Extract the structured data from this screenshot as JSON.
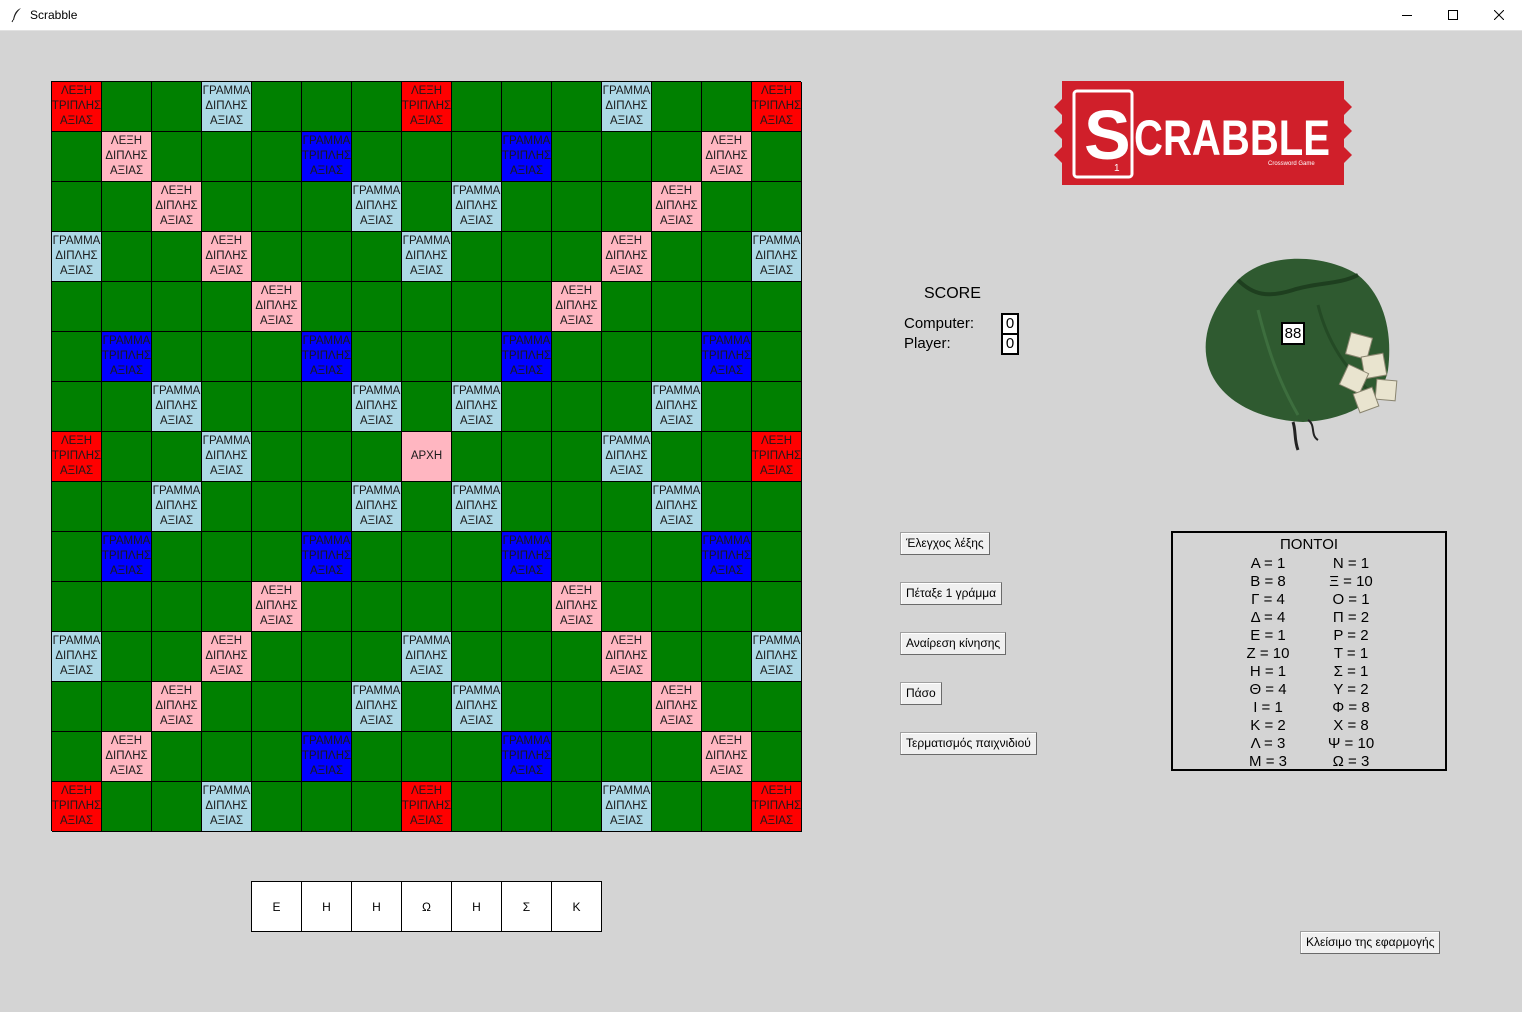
{
  "window": {
    "title": "Scrabble"
  },
  "board": {
    "rows": [
      [
        "TW",
        "",
        "",
        "DL",
        "",
        "",
        "",
        "TW",
        "",
        "",
        "",
        "DL",
        "",
        "",
        "TW"
      ],
      [
        "",
        "DW",
        "",
        "",
        "",
        "TL",
        "",
        "",
        "",
        "TL",
        "",
        "",
        "",
        "DW",
        ""
      ],
      [
        "",
        "",
        "DW",
        "",
        "",
        "",
        "DL",
        "",
        "DL",
        "",
        "",
        "",
        "DW",
        "",
        ""
      ],
      [
        "DL",
        "",
        "",
        "DW",
        "",
        "",
        "",
        "DL",
        "",
        "",
        "",
        "DW",
        "",
        "",
        "DL"
      ],
      [
        "",
        "",
        "",
        "",
        "DW",
        "",
        "",
        "",
        "",
        "",
        "DW",
        "",
        "",
        "",
        ""
      ],
      [
        "",
        "TL",
        "",
        "",
        "",
        "TL",
        "",
        "",
        "",
        "TL",
        "",
        "",
        "",
        "TL",
        ""
      ],
      [
        "",
        "",
        "DL",
        "",
        "",
        "",
        "DL",
        "",
        "DL",
        "",
        "",
        "",
        "DL",
        "",
        ""
      ],
      [
        "TW",
        "",
        "",
        "DL",
        "",
        "",
        "",
        "ST",
        "",
        "",
        "",
        "DL",
        "",
        "",
        "TW"
      ],
      [
        "",
        "",
        "DL",
        "",
        "",
        "",
        "DL",
        "",
        "DL",
        "",
        "",
        "",
        "DL",
        "",
        ""
      ],
      [
        "",
        "TL",
        "",
        "",
        "",
        "TL",
        "",
        "",
        "",
        "TL",
        "",
        "",
        "",
        "TL",
        ""
      ],
      [
        "",
        "",
        "",
        "",
        "DW",
        "",
        "",
        "",
        "",
        "",
        "DW",
        "",
        "",
        "",
        ""
      ],
      [
        "DL",
        "",
        "",
        "DW",
        "",
        "",
        "",
        "DL",
        "",
        "",
        "",
        "DW",
        "",
        "",
        "DL"
      ],
      [
        "",
        "",
        "DW",
        "",
        "",
        "",
        "DL",
        "",
        "DL",
        "",
        "",
        "",
        "DW",
        "",
        ""
      ],
      [
        "",
        "DW",
        "",
        "",
        "",
        "TL",
        "",
        "",
        "",
        "TL",
        "",
        "",
        "",
        "DW",
        ""
      ],
      [
        "TW",
        "",
        "",
        "DL",
        "",
        "",
        "",
        "TW",
        "",
        "",
        "",
        "DL",
        "",
        "",
        "TW"
      ]
    ],
    "labels": {
      "TW": "ΛΕΞΗ\nΤΡΙΠΛΗΣ\nΑΞΙΑΣ",
      "DW": "ΛΕΞΗ\nΔΙΠΛΗΣ\nΑΞΙΑΣ",
      "DL": "ΓΡΑΜΜΑ\nΔΙΠΛΗΣ\nΑΞΙΑΣ",
      "TL": "ΓΡΑΜΜΑ\nΤΡΙΠΛΗΣ\nΑΞΙΑΣ",
      "ST": "ΑΡΧΗ"
    }
  },
  "rack": [
    "Ε",
    "Η",
    "Η",
    "Ω",
    "Η",
    "Σ",
    "Κ"
  ],
  "logo": {
    "text": "SCRABBLE",
    "tile_number": "1",
    "subtitle": "Crossword Game"
  },
  "score": {
    "title": "SCORE",
    "computer_label": "Computer:",
    "computer_value": "0",
    "player_label": "Player:",
    "player_value": "0"
  },
  "bag": {
    "remaining": "88"
  },
  "buttons": {
    "check_word": "Έλεγχος λέξης",
    "throw_letter": "Πέταξε 1 γράμμα",
    "undo_move": "Αναίρεση κίνησης",
    "pass": "Πάσο",
    "end_game": "Τερματισμός παιχνιδιού",
    "close_app": "Κλείσιμο της εφαρμογής"
  },
  "points": {
    "title": "ΠΟΝΤΟΙ",
    "rows": [
      [
        "Α = 1",
        "Ν = 1"
      ],
      [
        "Β = 8",
        "Ξ = 10"
      ],
      [
        "Γ = 4",
        "Ο = 1"
      ],
      [
        "Δ = 4",
        "Π = 2"
      ],
      [
        "Ε = 1",
        "Ρ = 2"
      ],
      [
        "Ζ = 10",
        "Τ = 1"
      ],
      [
        "Η = 1",
        "Σ = 1"
      ],
      [
        "Θ = 4",
        "Υ = 2"
      ],
      [
        "Ι = 1",
        "Φ = 8"
      ],
      [
        "Κ = 2",
        "Χ = 8"
      ],
      [
        "Λ = 3",
        "Ψ = 10"
      ],
      [
        "Μ = 3",
        "Ω = 3"
      ]
    ]
  },
  "colors": {
    "board_green": "#008000",
    "triple_word": "#ff0000",
    "double_word": "#ffb6c1",
    "double_letter": "#add8e6",
    "triple_letter": "#0000ff",
    "background": "#d4d4d4",
    "logo_red": "#d01f2a"
  }
}
